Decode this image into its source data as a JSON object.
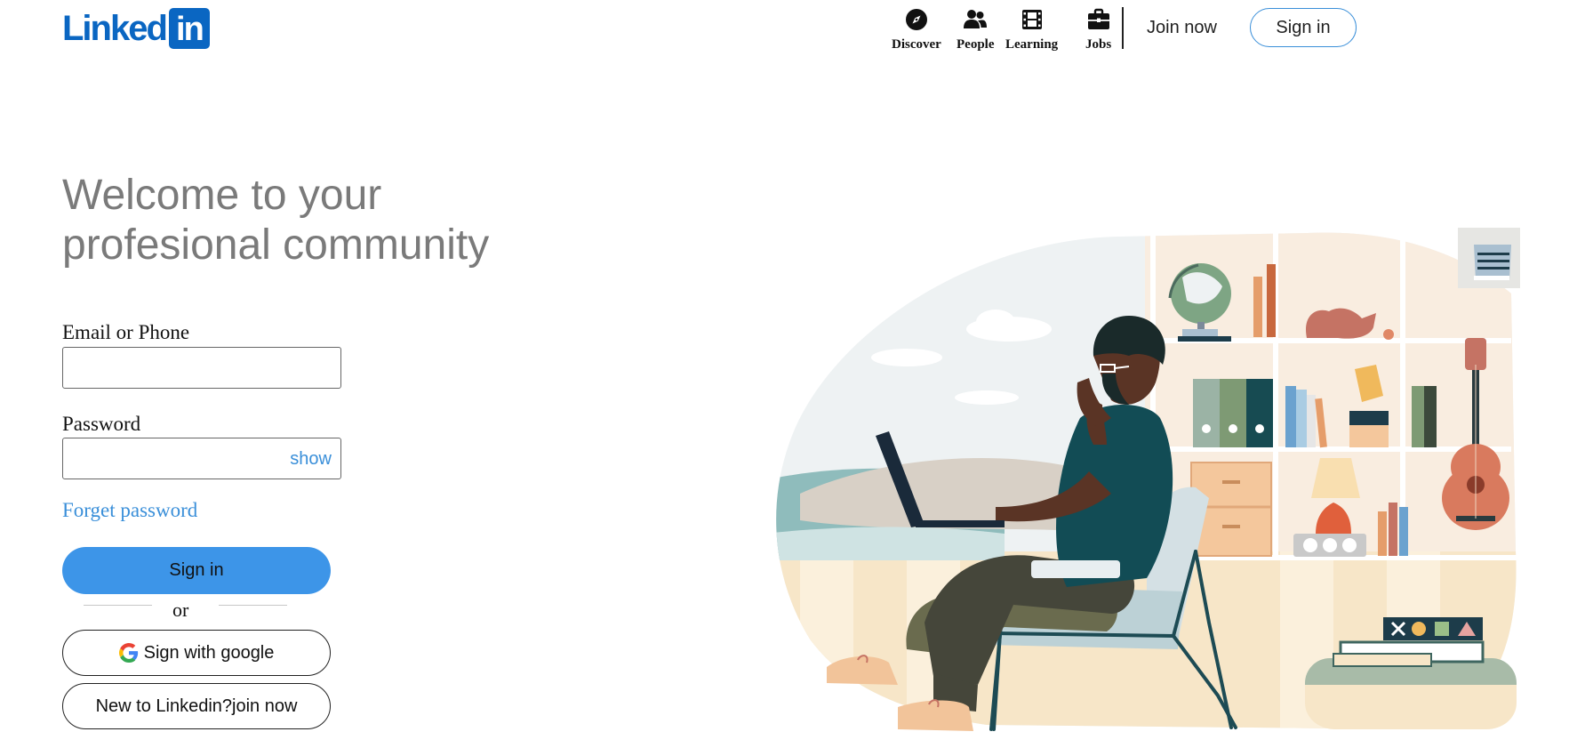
{
  "header": {
    "logo": {
      "word": "Linked",
      "box": "in"
    },
    "nav": [
      {
        "label": "Discover",
        "icon": "compass-icon"
      },
      {
        "label": "People",
        "icon": "people-icon"
      },
      {
        "label": "Learning",
        "icon": "film-icon"
      },
      {
        "label": "Jobs",
        "icon": "briefcase-icon"
      }
    ],
    "join_now": "Join now",
    "sign_in": "Sign in"
  },
  "hero": {
    "headline": "Welcome to your profesional community"
  },
  "form": {
    "email_label": "Email or Phone",
    "email_value": "",
    "password_label": "Password",
    "password_value": "",
    "show_label": "show",
    "forget_password": "Forget password",
    "sign_in": "Sign in",
    "or": "or",
    "google": "Sign with google",
    "join": "New to Linkedin?join now"
  },
  "colors": {
    "brand": "#0a66c2",
    "accent": "#3d95e8",
    "link": "#3a8fd9",
    "headline": "#7a7a7a"
  },
  "illustration": {
    "icon": "person-working-on-laptop-illustration"
  }
}
